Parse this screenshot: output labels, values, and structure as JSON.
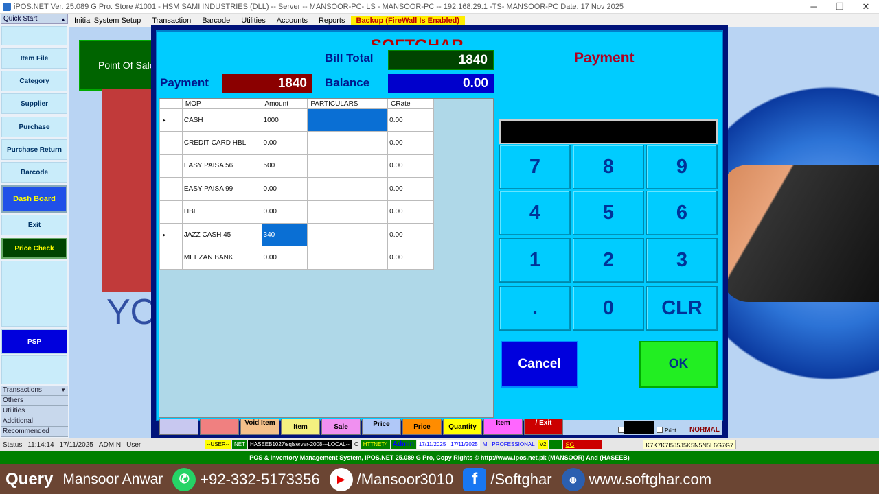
{
  "window": {
    "title": "iPOS.NET Ver. 25.089 G Pro. Store #1001 - HSM SAMI INDUSTRIES (DLL) -- Server -- MANSOOR-PC- LS - MANSOOR-PC -- 192.168.29.1 -TS- MANSOOR-PC Date.  17 Nov 2025",
    "minimize": "─",
    "restore": "❐",
    "close": "✕"
  },
  "menu": {
    "items": [
      "Initial System Setup",
      "Transaction",
      "Barcode",
      "Utilities",
      "Accounts",
      "Reports"
    ],
    "backup": "Backup (FireWall Is Enabled)"
  },
  "sidebar": {
    "quick_start": "Quick Start",
    "items": [
      "Item File",
      "Category",
      "Supplier",
      "Purchase",
      "Purchase Return",
      "Barcode"
    ],
    "dashboard": "Dash Board",
    "exit": "Exit",
    "price_check": "Price Check",
    "psp": "PSP",
    "footer": [
      "Transactions",
      "Others",
      "Utilities",
      "Additional",
      "Recommended"
    ]
  },
  "background": {
    "pos_label": "Point Of Sale",
    "softghar": "SOFTGHAR",
    "you": "YO"
  },
  "dialog": {
    "bill_total_label": "Bill Total",
    "bill_total": "1840",
    "payment_label": "Payment",
    "payment": "1840",
    "balance_label": "Balance",
    "balance": "0.00",
    "title": "Payment",
    "columns": [
      "MOP",
      "Amount",
      "PARTICULARS",
      "CRate"
    ],
    "rows": [
      {
        "marker": "▸",
        "mop": "CASH",
        "amount": "1000",
        "particulars": "",
        "crate": "0.00"
      },
      {
        "marker": "",
        "mop": "CREDIT CARD HBL",
        "amount": "0.00",
        "particulars": "",
        "crate": "0.00"
      },
      {
        "marker": "",
        "mop": "EASY PAISA 56",
        "amount": "500",
        "particulars": "",
        "crate": "0.00"
      },
      {
        "marker": "",
        "mop": "EASY PAISA 99",
        "amount": "0.00",
        "particulars": "",
        "crate": "0.00"
      },
      {
        "marker": "",
        "mop": "HBL",
        "amount": "0.00",
        "particulars": "",
        "crate": "0.00"
      },
      {
        "marker": "▸",
        "mop": "JAZZ CASH 45",
        "amount": "340",
        "particulars": "",
        "crate": "0.00"
      },
      {
        "marker": "",
        "mop": "MEEZAN BANK",
        "amount": "0.00",
        "particulars": "",
        "crate": "0.00"
      }
    ],
    "keypad": [
      "7",
      "8",
      "9",
      "4",
      "5",
      "6",
      "1",
      "2",
      "3",
      ".",
      "0",
      "CLR"
    ],
    "cancel": "Cancel",
    "ok": "OK"
  },
  "toolbar": {
    "buttons": [
      "",
      "",
      "Void Item",
      "Item",
      "Sale",
      "Price",
      "Price",
      "Quantity",
      "Item",
      "/ Exit"
    ],
    "print": "Print",
    "normal": "NORMAL"
  },
  "status": {
    "label": "Status",
    "time": "11:14:14",
    "date": "17/11/2025",
    "user": "ADMIN",
    "user_label": "User",
    "user_tag": "--USER--",
    "net": "NET",
    "server": "HASEEB1027\\sqlserver-2008---LOCAL--",
    "c": "C",
    "version_tag": "HTTNET4",
    "admin": "Admin",
    "d1": "17/11/2025",
    "d2": "17/11/2025",
    "m": "M",
    "pro": "PROFESSIONAL",
    "v2": "V2",
    "sg": "SG UPDATE",
    "key": "K7K7K7I5J5J5K5N5N5L6G7G7"
  },
  "copyright": "POS  & Inventory Management System,  iPOS.NET 25.089 G Pro, Copy Rights © http://www.ipos.net.pk  (MANSOOR) And (HASEEB)",
  "footer": {
    "query": "Query",
    "name": "Mansoor Anwar",
    "phone": "+92-332-5173356",
    "youtube": "/Mansoor3010",
    "facebook": "/Softghar",
    "web": "www.softghar.com"
  }
}
